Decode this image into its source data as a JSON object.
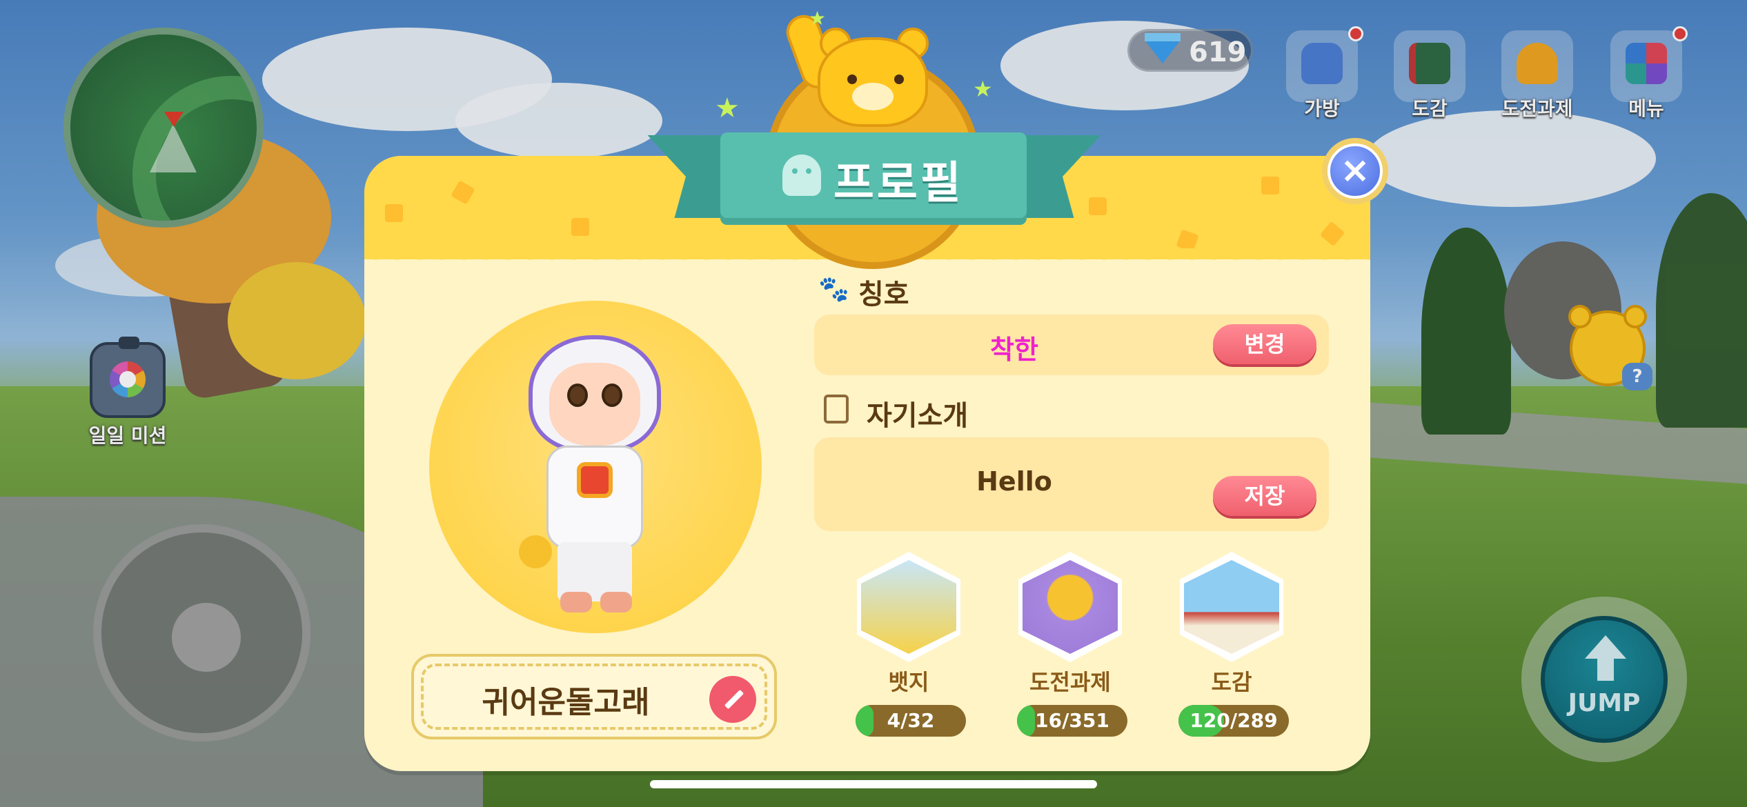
{
  "hud": {
    "gem_count": "619",
    "daily_mission_label": "일일 미션",
    "top_buttons": [
      {
        "label": "가방",
        "icon": "backpack-icon",
        "notification": true
      },
      {
        "label": "도감",
        "icon": "book-icon",
        "notification": false
      },
      {
        "label": "도전과제",
        "icon": "trophy-icon",
        "notification": false
      },
      {
        "label": "메뉴",
        "icon": "menu-grid-icon",
        "notification": true
      }
    ],
    "jump_label": "JUMP",
    "help_label": "?"
  },
  "profile": {
    "title": "프로필",
    "close_glyph": "×",
    "nickname": "귀어운돌고래",
    "title_section": {
      "heading": "칭호",
      "value": "착한",
      "value_color": "#ee22cc",
      "button": "변경"
    },
    "intro_section": {
      "heading": "자기소개",
      "value": "Hello",
      "button": "저장"
    },
    "stats": [
      {
        "label": "뱃지",
        "progress": "4/32",
        "fraction": 0.125,
        "icon": "reading-bear-badge-icon"
      },
      {
        "label": "도전과제",
        "progress": "16/351",
        "fraction": 0.046,
        "icon": "trophy-badge-icon"
      },
      {
        "label": "도감",
        "progress": "120/289",
        "fraction": 0.415,
        "icon": "koala-book-badge-icon"
      }
    ]
  },
  "colors": {
    "panel_bg": "#fff4c6",
    "header_yellow": "#ffd94a",
    "ribbon_teal": "#58bfae",
    "button_pink": "#f0606e",
    "progress_green": "#45c24a",
    "text_brown": "#5a3a12"
  }
}
